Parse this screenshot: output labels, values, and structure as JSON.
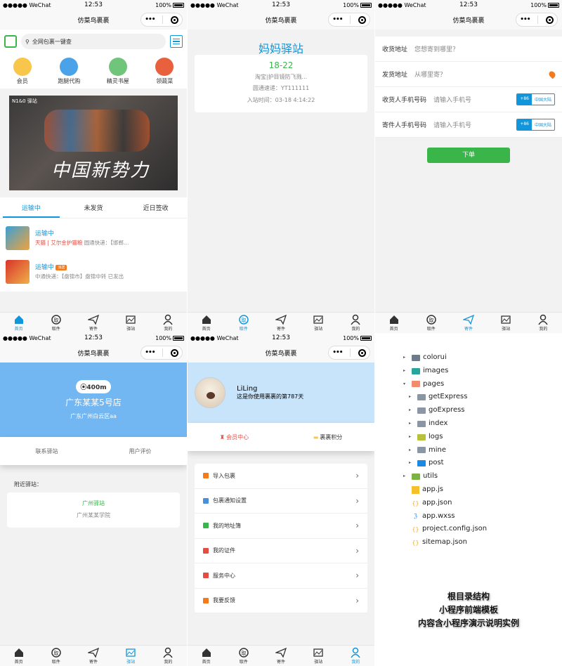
{
  "status": {
    "carrier": "●●●●● WeChat",
    "time": "12:53",
    "battery": "100%"
  },
  "app_title": "仿菜鸟裹裹",
  "capsule": {
    "more": "•••"
  },
  "tabbar": [
    "首页",
    "取件",
    "寄件",
    "驿站",
    "我的"
  ],
  "home": {
    "search_placeholder": "全网包裹一键查",
    "quick": [
      {
        "label": "会员",
        "color": "#f7c64a"
      },
      {
        "label": "跑腿代购",
        "color": "#4aa3e8"
      },
      {
        "label": "精灵书屋",
        "color": "#6fc57a"
      },
      {
        "label": "领蔬菜",
        "color": "#e8603c"
      }
    ],
    "banner_logo": "N1&0 驿站",
    "banner_slogan": "中国新势力",
    "tabs": [
      "运输中",
      "未发货",
      "近日签收"
    ],
    "orders": [
      {
        "status": "运输中",
        "line2a": "天猫 | 艾尔金护猫粮",
        "line2b": "圆通快递：【邯郸…",
        "thumb": "#3aa0d8"
      },
      {
        "status": "运输中",
        "badge": "派送",
        "line2b": "中通快递：【盘锦市】盘锦中转 已发出",
        "thumb": "#d8332a"
      }
    ]
  },
  "pickup": {
    "station": "妈妈驿站",
    "code": "18-22",
    "from": "淘宝|护目镜防飞溅...",
    "tracking": "圆通速递：YT111111",
    "time": "入站时间：03-18 4:14:22"
  },
  "send": {
    "rows": [
      {
        "label": "收货地址",
        "placeholder": "您想寄到哪里？"
      },
      {
        "label": "发货地址",
        "placeholder": "从哪里寄？"
      },
      {
        "label": "收货人手机号码",
        "placeholder": "请输入手机号",
        "code": "+86",
        "region": "中国大陆"
      },
      {
        "label": "寄件人手机号码",
        "placeholder": "请输入手机号",
        "code": "+86",
        "region": "中国大陆"
      }
    ],
    "submit": "下单"
  },
  "station": {
    "distance": "400m",
    "name": "广东某某5号店",
    "addr": "广东广州白云区aa",
    "btn1": "联系驿站",
    "btn2": "用户评价",
    "near_label": "附近驿站：",
    "near_name": "广州驿站",
    "near_addr": "广州某某学院"
  },
  "mine": {
    "name": "LiLing",
    "days": "这是你使用裹裹的第787天",
    "vip": "会员中心",
    "points": "裹裹积分",
    "menu": [
      {
        "t": "导入包裹",
        "c": "#f37b1d"
      },
      {
        "t": "包裹通知设置",
        "c": "#4a8fd8"
      },
      {
        "t": "我的地址簿",
        "c": "#39b54a"
      },
      {
        "t": "我的证件",
        "c": "#e54d42"
      },
      {
        "t": "服务中心",
        "c": "#e54d42"
      },
      {
        "t": "我要反馈",
        "c": "#f37b1d"
      }
    ]
  },
  "tree": [
    {
      "indent": 0,
      "arrow": "▸",
      "type": "folder",
      "color": "#6d7b8d",
      "name": "colorui"
    },
    {
      "indent": 0,
      "arrow": "▸",
      "type": "folder",
      "color": "#26a69a",
      "name": "images"
    },
    {
      "indent": 0,
      "arrow": "▾",
      "type": "folder",
      "color": "#f48a6f",
      "name": "pages"
    },
    {
      "indent": 1,
      "arrow": "▸",
      "type": "folder",
      "color": "#8a96a3",
      "name": "getExpress"
    },
    {
      "indent": 1,
      "arrow": "▸",
      "type": "folder",
      "color": "#8a96a3",
      "name": "goExpress"
    },
    {
      "indent": 1,
      "arrow": "▸",
      "type": "folder",
      "color": "#8a96a3",
      "name": "index"
    },
    {
      "indent": 1,
      "arrow": "▸",
      "type": "folder",
      "color": "#b5c23a",
      "name": "logs"
    },
    {
      "indent": 1,
      "arrow": "▸",
      "type": "folder",
      "color": "#8a96a3",
      "name": "mine"
    },
    {
      "indent": 1,
      "arrow": "▸",
      "type": "folder",
      "color": "#1e88e5",
      "name": "post"
    },
    {
      "indent": 0,
      "arrow": "▸",
      "type": "folder",
      "color": "#7cb342",
      "name": "utils"
    },
    {
      "indent": 0,
      "arrow": "",
      "type": "js",
      "color": "#f5c02b",
      "name": "app.js"
    },
    {
      "indent": 0,
      "arrow": "",
      "type": "json",
      "color": "#f5a623",
      "name": "app.json"
    },
    {
      "indent": 0,
      "arrow": "",
      "type": "wxss",
      "color": "#1e88e5",
      "name": "app.wxss"
    },
    {
      "indent": 0,
      "arrow": "",
      "type": "json",
      "color": "#f5a623",
      "name": "project.config.json"
    },
    {
      "indent": 0,
      "arrow": "",
      "type": "json",
      "color": "#f5a623",
      "name": "sitemap.json"
    }
  ],
  "caption": [
    "根目录结构",
    "小程序前端模板",
    "内容含小程序演示说明实例"
  ]
}
